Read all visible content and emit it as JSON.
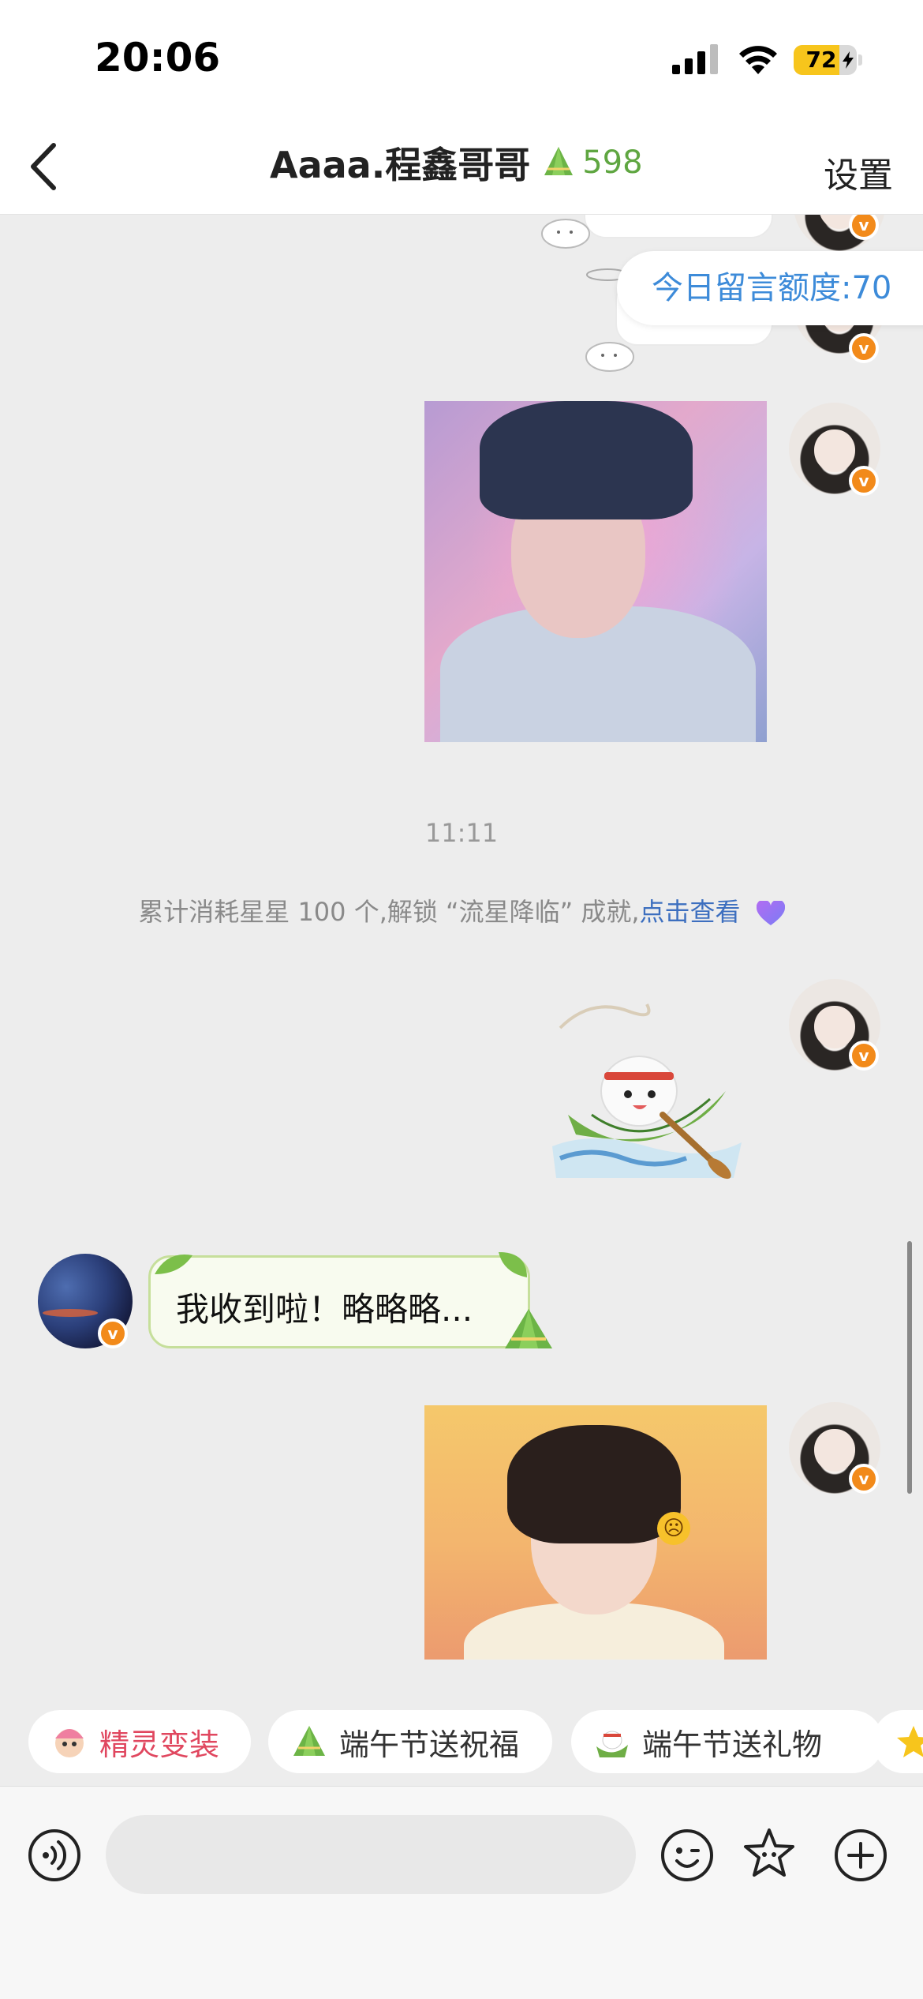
{
  "status_bar": {
    "time": "20:06",
    "battery": "72",
    "battery_level": 0.72,
    "icons": [
      "cellular-signal-icon",
      "wifi-icon",
      "battery-charging-icon"
    ]
  },
  "header": {
    "title": "Aaaa.程鑫哥哥",
    "star_count": "598",
    "settings_label": "设置",
    "icons": [
      "back-chevron-icon",
      "zongzi-icon"
    ]
  },
  "chat": {
    "quota_tag": "今日留言额度:70",
    "timestamp": "11:11",
    "system_message": {
      "text": "累计消耗星星 100 个,解锁 “流星降临” 成就,",
      "link": "点击查看"
    },
    "messages": [
      {
        "from": "other",
        "text": "我收到啦！略略略..."
      }
    ]
  },
  "quick_actions": [
    {
      "label": "精灵变装",
      "icon": "sprite-icon"
    },
    {
      "label": "端午节送祝福",
      "icon": "zongzi-icon"
    },
    {
      "label": "端午节送礼物",
      "icon": "gift-icon"
    }
  ],
  "input_bar": {
    "value": "",
    "icons": [
      "voice-icon",
      "emoji-icon",
      "star-icon",
      "plus-icon"
    ]
  },
  "colors": {
    "accent_green": "#5fa641",
    "link_blue": "#3d6fbf",
    "quota_blue": "#3d8bd9",
    "chip_red": "#e0475f",
    "badge_orange": "#f28a1a",
    "battery_yellow": "#f7c51c"
  }
}
